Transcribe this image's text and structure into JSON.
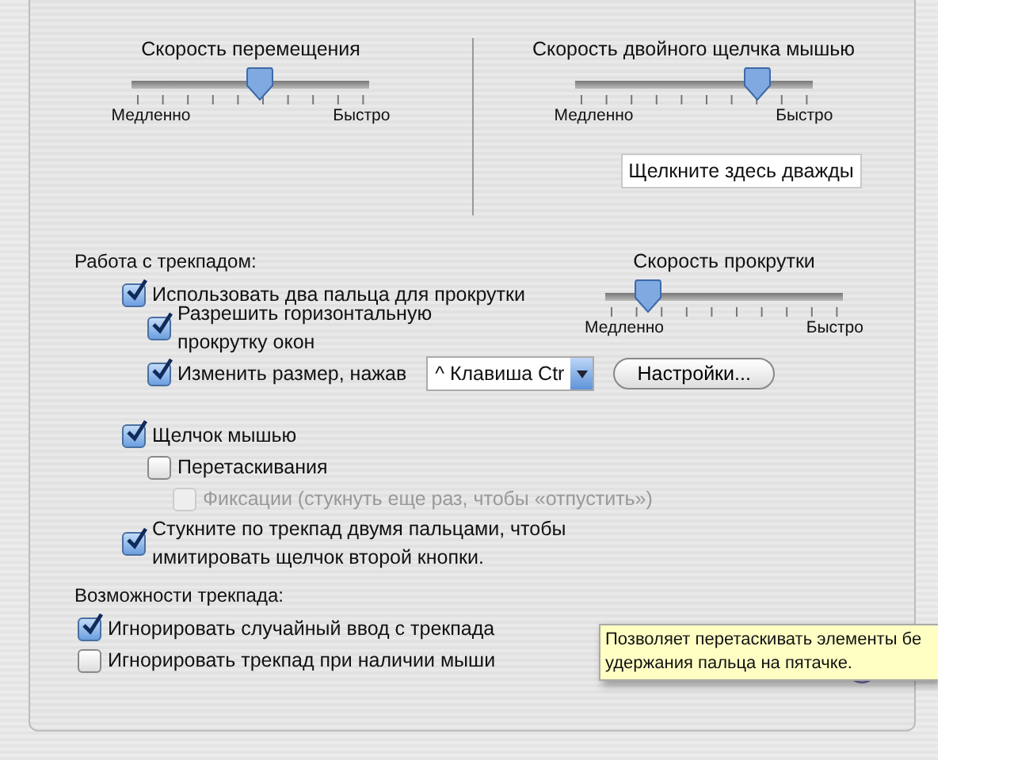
{
  "tracking": {
    "title": "Скорость перемещения",
    "level": 0.54,
    "min_label": "Медленно",
    "max_label": "Быстро"
  },
  "double_click": {
    "title": "Скорость двойного щелчка мышью",
    "level": 0.77,
    "min_label": "Медленно",
    "max_label": "Быстро",
    "test_field": "Щелкните здесь дважды"
  },
  "trackpad": {
    "heading": "Работа с трекпадом:",
    "scroll_speed": {
      "title": "Скорость прокрутки",
      "level": 0.18,
      "min_label": "Медленно",
      "max_label": "Быстро"
    },
    "options": [
      {
        "kind": "checkbox",
        "label": "Использовать два пальца для прокрутки",
        "checked": true,
        "disabled": false,
        "children": [
          {
            "kind": "checkbox",
            "label": "Разрешить горизонтальную\nпрокрутку окон",
            "checked": true,
            "disabled": false
          },
          {
            "kind": "popup",
            "label": "Изменить размер, нажав",
            "checked": true,
            "disabled": false,
            "popup": "^ Клавиша Ctr",
            "button": "Настройки..."
          }
        ]
      },
      {
        "kind": "checkbox",
        "label": "Щелчок мышью",
        "checked": true,
        "disabled": false,
        "children": [
          {
            "kind": "checkbox",
            "label": "Перетаскивания",
            "checked": false,
            "disabled": false,
            "children": [
              {
                "kind": "checkbox",
                "label": "Фиксации (стукнуть еще раз, чтобы «отпустить»)",
                "checked": false,
                "disabled": true
              }
            ]
          }
        ]
      },
      {
        "kind": "checkbox",
        "label": "Стукните по трекпад двумя пальцами, чтобы\nимитировать щелчок второй кнопки.",
        "checked": true,
        "disabled": false
      }
    ]
  },
  "features": {
    "heading": "Возможности трекпада:",
    "options": [
      {
        "kind": "checkbox",
        "label": "Игнорировать случайный ввод с трекпада",
        "checked": true,
        "disabled": false
      },
      {
        "kind": "checkbox",
        "label": "Игнорировать трекпад при наличии мыши",
        "checked": false,
        "disabled": false
      }
    ]
  },
  "tooltip": "Позволяет перетаскивать элементы бе\nудержания пальца на пятачке."
}
